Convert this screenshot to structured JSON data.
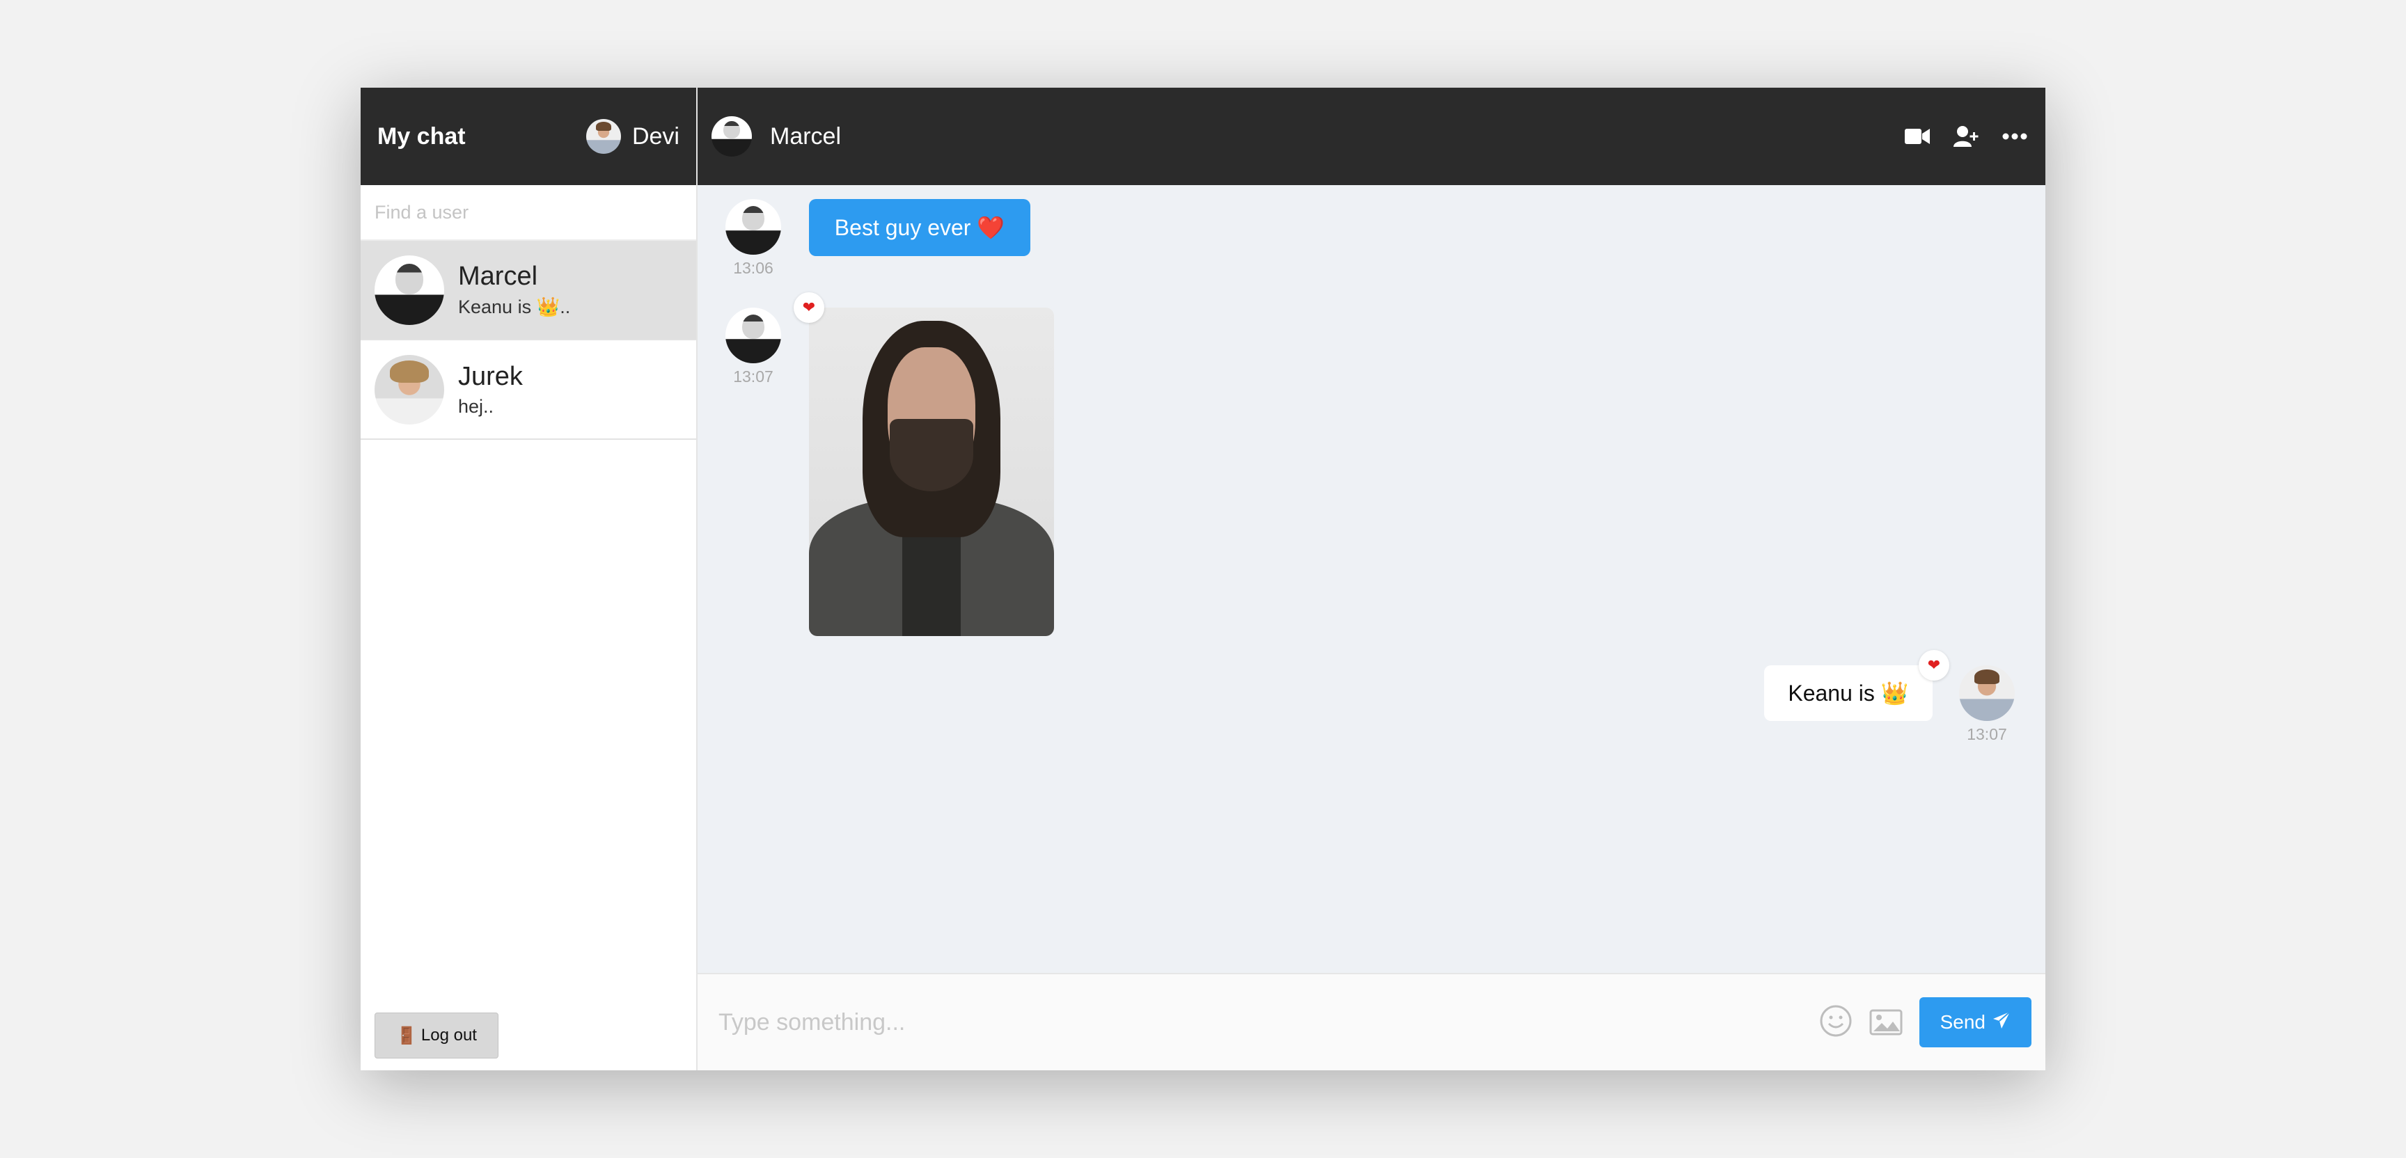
{
  "sidebar": {
    "app_title": "My chat",
    "current_user": "Devi",
    "search_placeholder": "Find a user",
    "users": [
      {
        "name": "Marcel",
        "last_message": "Keanu is 👑..",
        "active": true
      },
      {
        "name": "Jurek",
        "last_message": "hej..",
        "active": false
      }
    ],
    "logout_label": "Log out",
    "logout_icon": "🚪"
  },
  "chat": {
    "partner_name": "Marcel",
    "header_icons": [
      "video-camera-icon",
      "add-user-icon",
      "more-options-icon"
    ],
    "messages": [
      {
        "from": "Marcel",
        "type": "text",
        "text": "Best guy ever ❤️",
        "time": "13:06"
      },
      {
        "from": "Marcel",
        "type": "image",
        "time": "13:07",
        "reaction": "❤"
      },
      {
        "from": "Devi",
        "type": "text",
        "text": "Keanu is 👑",
        "time": "13:07",
        "reaction": "❤"
      }
    ]
  },
  "composer": {
    "placeholder": "Type something...",
    "send_label": "Send",
    "icons": [
      "emoji-icon",
      "image-upload-icon",
      "paper-plane-icon"
    ]
  },
  "colors": {
    "header_bg": "#2b2b2b",
    "accent": "#2d9bf0",
    "chat_bg": "#eef1f5",
    "active_item": "#e0e0e0",
    "reaction": "#e02020"
  }
}
